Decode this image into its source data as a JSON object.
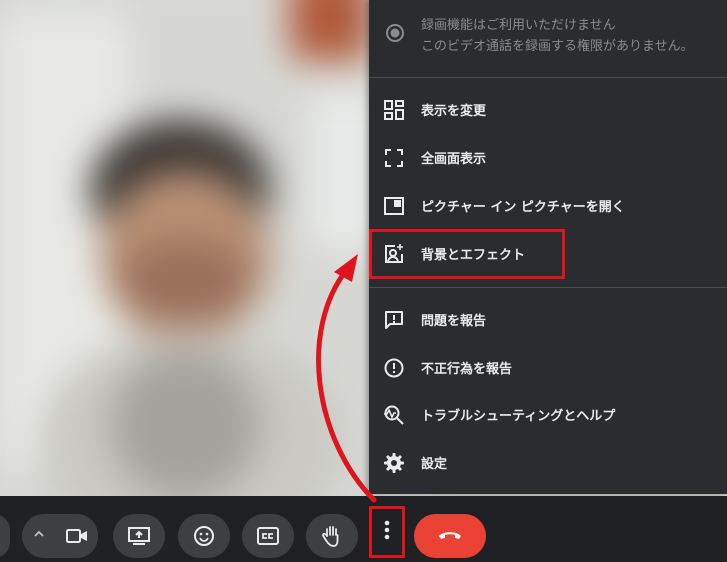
{
  "recording": {
    "line1": "録画機能はご利用いただけません",
    "line2": "このビデオ通話を録画する権限がありません。"
  },
  "menu": {
    "items": [
      {
        "label": "表示を変更",
        "icon": "grid-layout-icon"
      },
      {
        "label": "全画面表示",
        "icon": "fullscreen-icon"
      },
      {
        "label": "ピクチャー イン ピクチャーを開く",
        "icon": "picture-in-picture-icon"
      },
      {
        "label": "背景とエフェクト",
        "icon": "background-effects-icon"
      },
      {
        "label": "問題を報告",
        "icon": "report-problem-icon"
      },
      {
        "label": "不正行為を報告",
        "icon": "report-abuse-icon"
      },
      {
        "label": "トラブルシューティングとヘルプ",
        "icon": "troubleshoot-icon"
      },
      {
        "label": "設定",
        "icon": "settings-gear-icon"
      }
    ]
  },
  "toolbar": {
    "buttons": [
      "mic-button",
      "expand-options-button",
      "camera-button",
      "present-screen-button",
      "emoji-reaction-button",
      "captions-button",
      "raise-hand-button",
      "more-options-button",
      "end-call-button"
    ]
  },
  "colors": {
    "menu_bg": "#2b2c2f",
    "toolbar_bg": "#202124",
    "button_bg": "#3c4043",
    "end_call": "#ea4335",
    "annotation_red": "#e0141c"
  }
}
